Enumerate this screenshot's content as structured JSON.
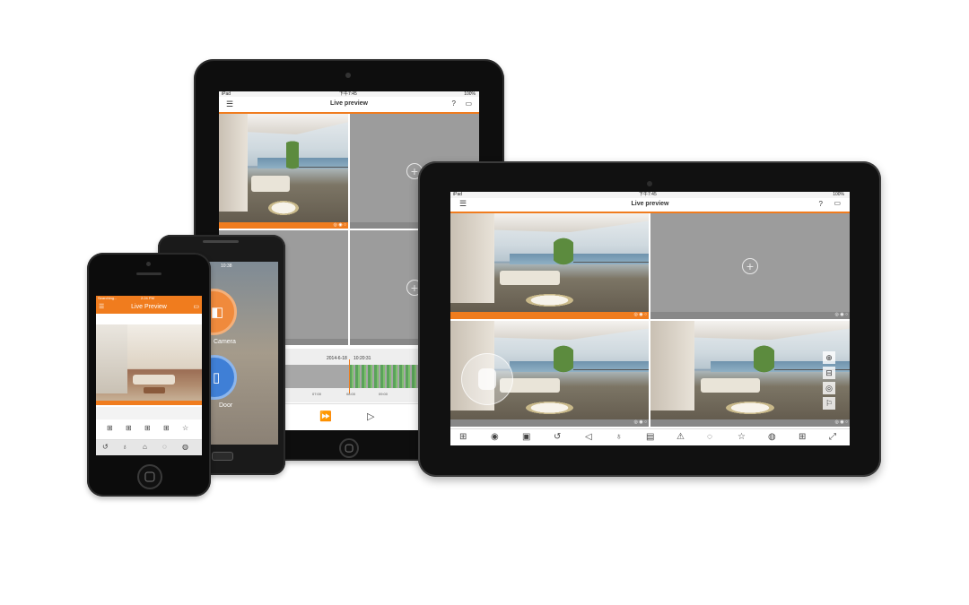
{
  "ipad_back": {
    "status": {
      "carrier": "iPad",
      "time": "下午7:45",
      "battery": "100%"
    },
    "title": "Live preview",
    "timeline": {
      "date": "2014-6-18",
      "time": "10:20:31",
      "ticks": [
        "07:00",
        "08:00",
        "09:00"
      ]
    }
  },
  "android_phone": {
    "status_time": "10:38",
    "menu": [
      {
        "label": "Camera",
        "icon": "camera-icon"
      },
      {
        "label": "Door",
        "icon": "door-icon"
      }
    ]
  },
  "iphone": {
    "status": {
      "carrier": "Searching...",
      "time": "2:24 PM"
    },
    "title": "Live Preview",
    "toolbar_icons": [
      "layout-icon",
      "layout-icon",
      "layout-icon",
      "layout-icon",
      "star-icon"
    ],
    "control_icons": [
      "playback-icon",
      "microphone-icon",
      "lock-icon",
      "ptz-icon",
      "color-icon"
    ]
  },
  "tablet": {
    "status": {
      "carrier": "iPad",
      "time": "下午7:45",
      "battery": "100%"
    },
    "title": "Live preview",
    "header_icons": [
      "menu-icon",
      "help-icon",
      "camera-list-icon"
    ],
    "toolbar_icons": [
      "layout-icon",
      "snapshot-icon",
      "record-icon",
      "playback-icon",
      "speaker-icon",
      "microphone-icon",
      "picture-icon",
      "alarm-icon",
      "ptz-icon",
      "favorite-icon",
      "color-icon",
      "split-icon",
      "fullscreen-icon"
    ],
    "side_icons": [
      "zoom-in-icon",
      "zoom-out-icon",
      "focus-icon",
      "iris-icon"
    ]
  },
  "accent_color": "#f07c1e"
}
